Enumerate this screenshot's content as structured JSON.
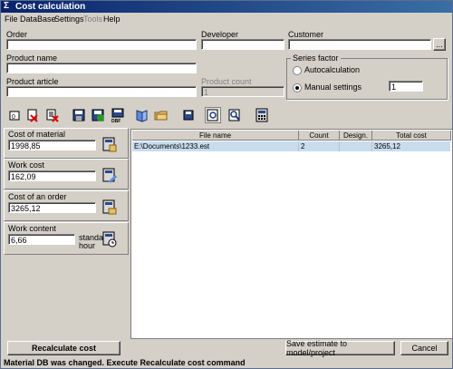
{
  "window": {
    "title": "Cost calculation",
    "app_icon": "sigma-icon"
  },
  "menu": [
    "File",
    "DataBase",
    "Settings",
    "Tools",
    "Help"
  ],
  "form": {
    "order_label": "Order",
    "developer_label": "Developer",
    "customer_label": "Customer",
    "customer_browse": "...",
    "product_name_label": "Product name",
    "product_article_label": "Product article",
    "product_count_label": "Product count",
    "product_count_value": "1"
  },
  "series_factor": {
    "title": "Series factor",
    "autocalc_label": "Autocalculation",
    "manual_label": "Manual settings",
    "value": "1",
    "selected": "manual"
  },
  "toolbar_icons": [
    "new-doc-icon",
    "delete-red-icon",
    "delete-rows-icon",
    "save-icon",
    "save-green-icon",
    "dbf-icon",
    "book-icon",
    "folder-icon",
    "save-small-icon",
    "preview-icon",
    "zoom-icon",
    "calculator-icon"
  ],
  "costs": {
    "material": {
      "label": "Cost of material",
      "value": "1998,85"
    },
    "work": {
      "label": "Work cost",
      "value": "162,09"
    },
    "order": {
      "label": "Cost of an order",
      "value": "3265,12"
    },
    "content": {
      "label": "Work content",
      "value": "6,66",
      "unit_line1": "standard",
      "unit_line2": "hour"
    }
  },
  "table": {
    "headers": [
      "File name",
      "Count",
      "Design.",
      "Total cost"
    ],
    "rows": [
      {
        "file": "E:\\Documents\\1233.est",
        "count": "2",
        "design": "",
        "total": "3265,12"
      }
    ]
  },
  "buttons": {
    "recalc": "Recalculate cost",
    "save": "Save estimate to model/project",
    "cancel": "Cancel"
  },
  "status": "Material DB was changed. Execute Recalculate cost command",
  "colors": {
    "title_start": "#0a246a",
    "title_end": "#3a6ea5",
    "selection": "#c8dcee",
    "face": "#d4d0c8"
  }
}
